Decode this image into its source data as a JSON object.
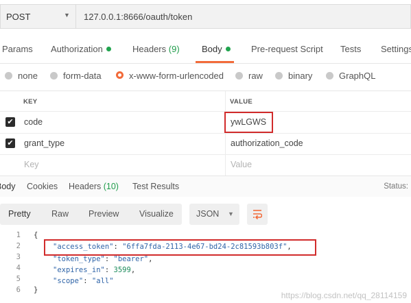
{
  "request": {
    "method": "POST",
    "url": "127.0.0.1:8666/oauth/token"
  },
  "request_tabs": {
    "params": "Params",
    "authorization": "Authorization",
    "headers": "Headers",
    "headers_count": "(9)",
    "body": "Body",
    "prerequest": "Pre-request Script",
    "tests": "Tests",
    "settings": "Settings"
  },
  "body_types": {
    "none": "none",
    "form_data": "form-data",
    "urlencoded": "x-www-form-urlencoded",
    "raw": "raw",
    "binary": "binary",
    "graphql": "GraphQL",
    "selected": "x-www-form-urlencoded"
  },
  "kv_table": {
    "key_header": "KEY",
    "value_header": "VALUE",
    "rows": [
      {
        "key": "code",
        "value": "ywLGWS",
        "checked": true
      },
      {
        "key": "grant_type",
        "value": "authorization_code",
        "checked": true
      }
    ],
    "key_placeholder": "Key",
    "value_placeholder": "Value"
  },
  "response_tabs": {
    "body": "Body",
    "cookies": "Cookies",
    "headers": "Headers",
    "headers_count": "(10)",
    "test_results": "Test Results",
    "status": "Status:"
  },
  "view_modes": {
    "pretty": "Pretty",
    "raw": "Raw",
    "preview": "Preview",
    "visualize": "Visualize",
    "format": "JSON"
  },
  "response_body": {
    "line_numbers": [
      "1",
      "2",
      "3",
      "4",
      "5",
      "6"
    ],
    "open_brace": "{",
    "close_brace": "}",
    "access_token_key": "\"access_token\"",
    "access_token_value": "\"6ffa7fda-2113-4e67-bd24-2c81593b803f\"",
    "token_type_key": "\"token_type\"",
    "token_type_value": "\"bearer\"",
    "expires_in_key": "\"expires_in\"",
    "expires_in_value": "3599",
    "scope_key": "\"scope\"",
    "scope_value": "\"all\""
  },
  "watermark": "https://blog.csdn.net/qq_28114159",
  "colors": {
    "accent": "#f26b3a",
    "active_dot": "#20a44e",
    "highlight_box": "#d12b2b",
    "json_key": "#2f64a8",
    "json_number": "#1a8a5a"
  },
  "icons": [
    "chevron-down-icon",
    "status-dot-icon",
    "checkbox-checked-icon",
    "wrap-lines-icon"
  ]
}
